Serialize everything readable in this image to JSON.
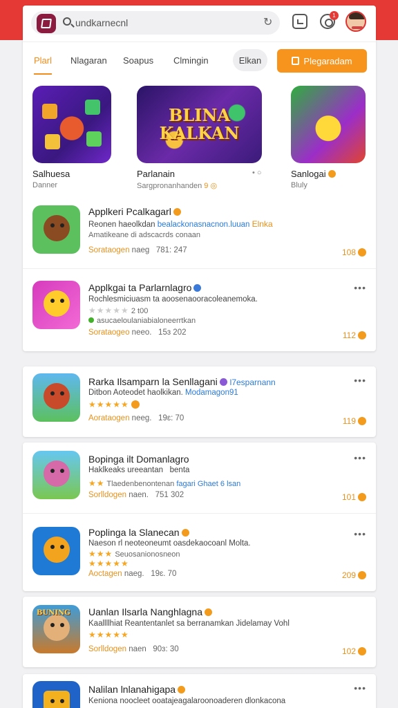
{
  "header": {
    "search_text": "undkarnecnl",
    "notification_count": "1"
  },
  "tabs": [
    {
      "label": "Plarl"
    },
    {
      "label": "Nlagaran"
    },
    {
      "label": "Soapus"
    },
    {
      "label": "Clmingin"
    }
  ],
  "actions": {
    "secondary_label": "Elkan",
    "primary_label": "Plegaradam"
  },
  "featured": [
    {
      "name": "Salhuesa",
      "sub": "Danner"
    },
    {
      "name": "Parlanain",
      "sub": "Sargpronanhanden",
      "badge_text": "9 ◎",
      "art_text": "BLINA KALKAN",
      "more": "• ○"
    },
    {
      "name": "Sanlogai",
      "sub": "Bluly"
    }
  ],
  "apps": [
    {
      "title": "Applkeri Pcalkagarl",
      "desc_a": "Reonen haeolkdan",
      "desc_link": "bealackonasnacnon.luuan",
      "desc_tag": "Elnka",
      "desc2": "Amatikeane di adscacrds conaan",
      "meta_label": "Sorataogen",
      "meta_b": "naeg",
      "meta_date": "781: 247",
      "count": "108",
      "more": "•••"
    },
    {
      "title": "Applkgai ta Parlarnlagro",
      "desc_a": "Rochlesmiciuasm ta aoosenaooracoleanemoka.",
      "rating_text": "2 t00",
      "desc2": "asucaeloulaniabialoneerrtkan",
      "meta_label": "Sorataogeo",
      "meta_b": "neeo.",
      "meta_date": "15ɜ 202",
      "count": "112",
      "more": "•••"
    },
    {
      "title": "Rarka Ilsamparn la Senllagani",
      "title_tag": "l7esparnann",
      "desc_a": "Ditbon Aoteodet haolkikan.",
      "desc_link": "Modamagon91",
      "meta_label": "Aorataogen",
      "meta_b": "neeg.",
      "meta_date": "19ɛ: 70",
      "count": "119",
      "more": "•••"
    },
    {
      "title": "Bopinga ilt Domanlagro",
      "desc_a": "Haklkeaks ureeantan",
      "desc_tag": "benta",
      "desc2": "Tlaedenbenontenan",
      "desc_link": "fagari Ghaet 6 lsan",
      "meta_label": "Sorlldogen",
      "meta_b": "naen.",
      "meta_date": "751 302",
      "count": "101",
      "more": "•••"
    },
    {
      "title": "Poplinga la Slanecan",
      "desc_a": "Naeson rl neoteoneumt oasdekaocoanl Molta.",
      "desc2": "Seuosanionosneon",
      "meta_label": "Aoctagen",
      "meta_b": "naeg.",
      "meta_date": "19ɛ. 70",
      "count": "209",
      "more": "•••"
    },
    {
      "title": "Uanlan Ilsarla Nanghlagna",
      "desc_a": "Kaallllhiat Reantentanlet sa berranamkan Jidelamay Vohl",
      "art_text": "BUNING",
      "meta_label": "Sorlldogen",
      "meta_b": "naen",
      "meta_date": "90ɜ: 30",
      "count": "102",
      "more": "•••"
    },
    {
      "title": "Nalilan lnlanahigapa",
      "desc_a": "Keniona noocleet ooatajeagalaroonoaderen dlonkacona",
      "more": "•••"
    }
  ],
  "colors": {
    "accent": "#f7941d",
    "brand_red": "#e53935",
    "link": "#2a7ad9"
  }
}
